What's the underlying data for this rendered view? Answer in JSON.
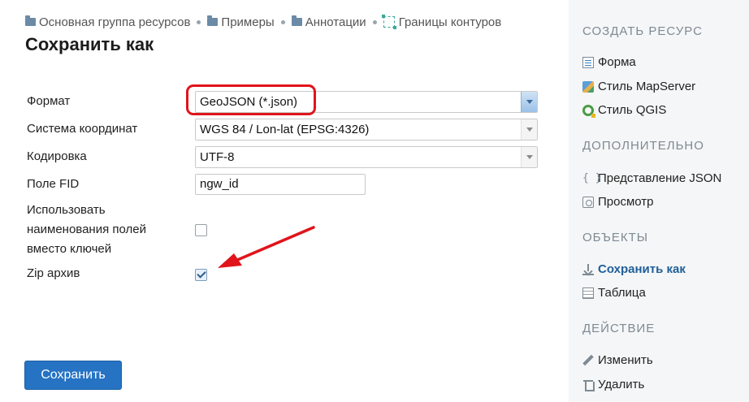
{
  "breadcrumb": [
    {
      "label": "Основная группа ресурсов",
      "icon": "folder-icon"
    },
    {
      "label": "Примеры",
      "icon": "folder-icon"
    },
    {
      "label": "Аннотации",
      "icon": "folder-icon"
    },
    {
      "label": "Границы контуров",
      "icon": "vector-layer-icon"
    }
  ],
  "page_title": "Сохранить как",
  "form": {
    "format": {
      "label": "Формат",
      "value": "GeoJSON (*.json)"
    },
    "crs": {
      "label": "Система координат",
      "value": "WGS 84 / Lon-lat (EPSG:4326)"
    },
    "encoding": {
      "label": "Кодировка",
      "value": "UTF-8"
    },
    "fid": {
      "label": "Поле FID",
      "value": "ngw_id"
    },
    "use_display_names": {
      "label_lines": [
        "Использовать",
        "наименования полей",
        "вместо ключей"
      ],
      "checked": false
    },
    "zip": {
      "label": "Zip архив",
      "checked": true
    },
    "submit_label": "Сохранить"
  },
  "sidebar": {
    "create": {
      "heading": "СОЗДАТЬ РЕСУРС",
      "items": [
        "Форма",
        "Стиль MapServer",
        "Стиль QGIS"
      ]
    },
    "extra": {
      "heading": "ДОПОЛНИТЕЛЬНО",
      "items": [
        "Представление JSON",
        "Просмотр"
      ]
    },
    "objects": {
      "heading": "ОБЪЕКТЫ",
      "items": [
        "Сохранить как",
        "Таблица"
      ]
    },
    "action": {
      "heading": "ДЕЙСТВИЕ",
      "items": [
        "Изменить",
        "Удалить"
      ]
    }
  },
  "colors": {
    "accent": "#2673c4",
    "annotation": "#e0141b",
    "sidebar_bg": "#f5f6f7",
    "current_link": "#1f5f99"
  }
}
